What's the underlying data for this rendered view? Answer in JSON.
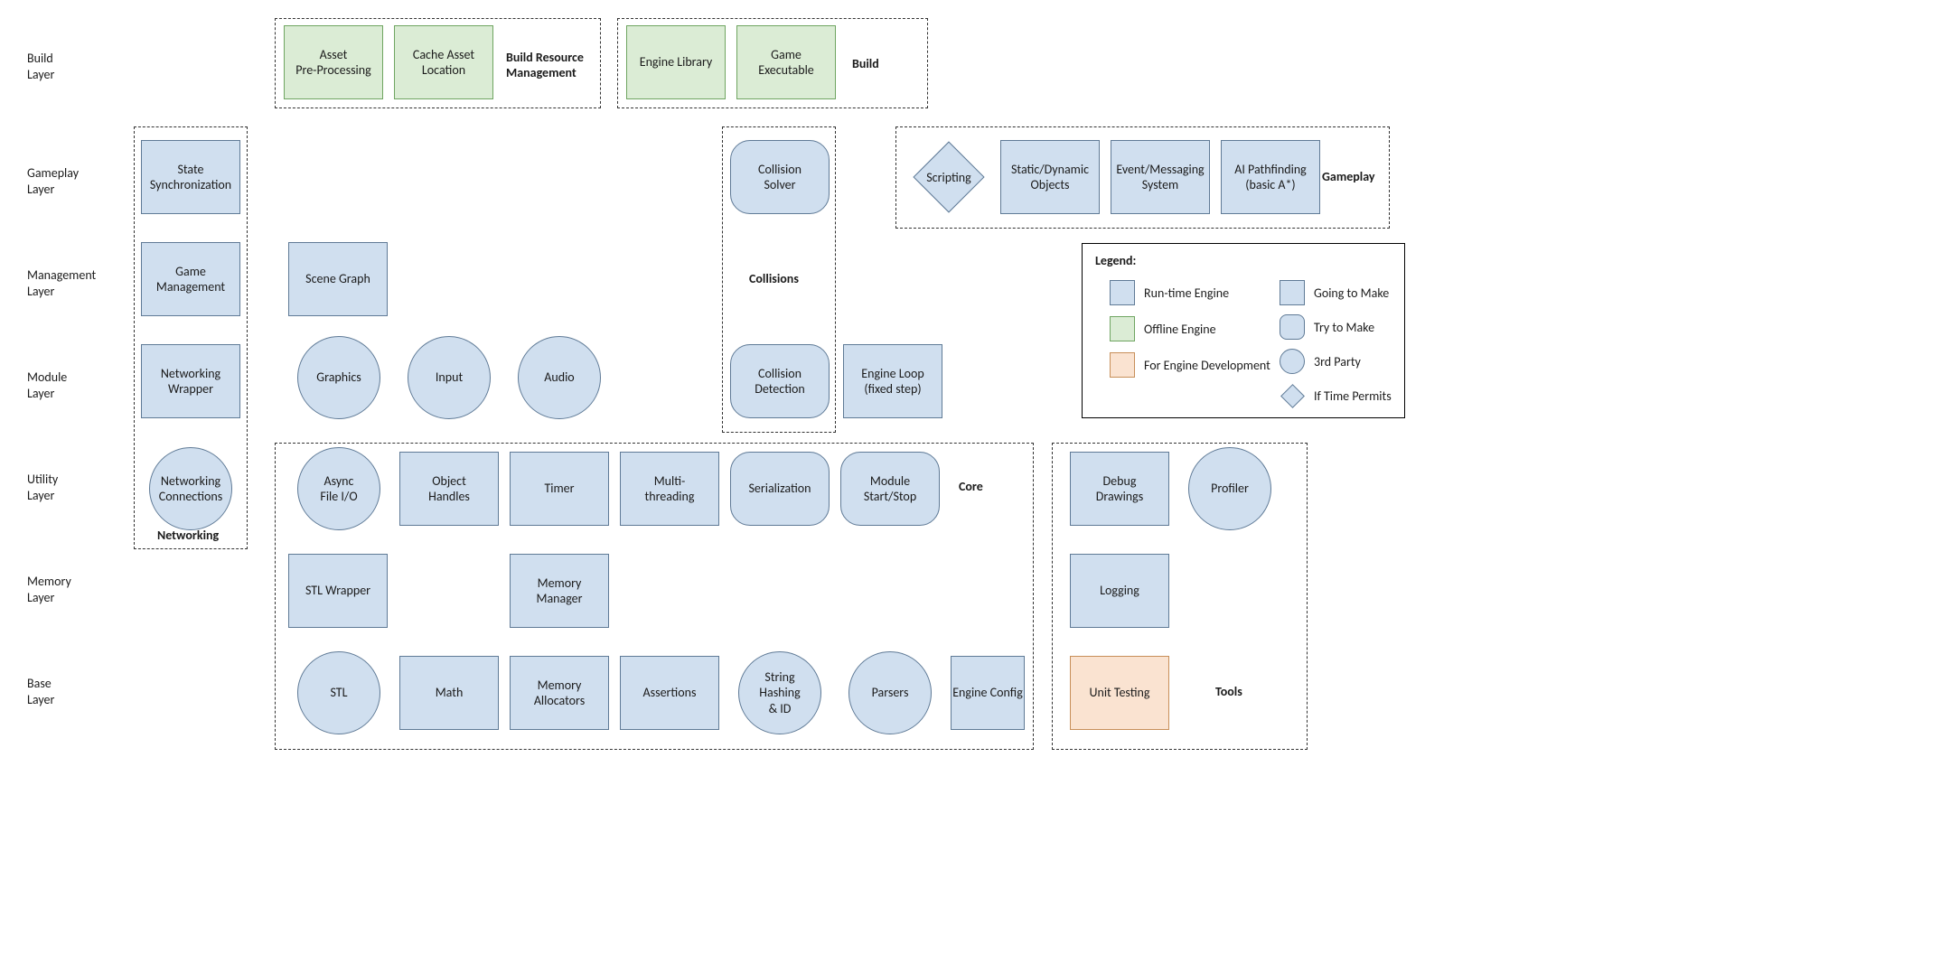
{
  "layers": {
    "build": "Build\nLayer",
    "gameplay": "Gameplay\nLayer",
    "management": "Management\nLayer",
    "module": "Module\nLayer",
    "utility": "Utility\nLayer",
    "memory": "Memory\nLayer",
    "base": "Base\nLayer"
  },
  "groups": {
    "build_resource_management": "Build Resource\nManagement",
    "build": "Build",
    "gameplay": "Gameplay",
    "collisions": "Collisions",
    "networking": "Networking",
    "core": "Core",
    "tools": "Tools"
  },
  "nodes": {
    "asset_pre_processing": "Asset\nPre-Processing",
    "cache_asset_location": "Cache Asset\nLocation",
    "engine_library": "Engine Library",
    "game_executable": "Game\nExecutable",
    "state_synchronization": "State\nSynchronization",
    "collision_solver": "Collision\nSolver",
    "scripting": "Scripting",
    "static_dynamic_objects": "Static/Dynamic\nObjects",
    "event_messaging_system": "Event/Messaging\nSystem",
    "ai_pathfinding": "AI Pathfinding\n(basic A*)",
    "game_management": "Game\nManagement",
    "scene_graph": "Scene Graph",
    "networking_wrapper": "Networking\nWrapper",
    "graphics": "Graphics",
    "input": "Input",
    "audio": "Audio",
    "collision_detection": "Collision\nDetection",
    "engine_loop": "Engine Loop\n(fixed step)",
    "networking_connections": "Networking\nConnections",
    "async_file_io": "Async\nFile I/O",
    "object_handles": "Object\nHandles",
    "timer": "Timer",
    "multi_threading": "Multi-\nthreading",
    "serialization": "Serialization",
    "module_start_stop": "Module\nStart/Stop",
    "stl_wrapper": "STL Wrapper",
    "memory_manager": "Memory\nManager",
    "stl": "STL",
    "math": "Math",
    "memory_allocators": "Memory\nAllocators",
    "assertions": "Assertions",
    "string_hashing_id": "String\nHashing\n& ID",
    "parsers": "Parsers",
    "engine_config": "Engine Config",
    "debug_drawings": "Debug\nDrawings",
    "profiler": "Profiler",
    "logging": "Logging",
    "unit_testing": "Unit Testing"
  },
  "legend": {
    "title": "Legend:",
    "runtime_engine": "Run-time Engine",
    "offline_engine": "Offline Engine",
    "for_engine_dev": "For Engine Development",
    "going_to_make": "Going to Make",
    "try_to_make": "Try to Make",
    "third_party": "3rd Party",
    "if_time_permits": "If Time Permits"
  }
}
